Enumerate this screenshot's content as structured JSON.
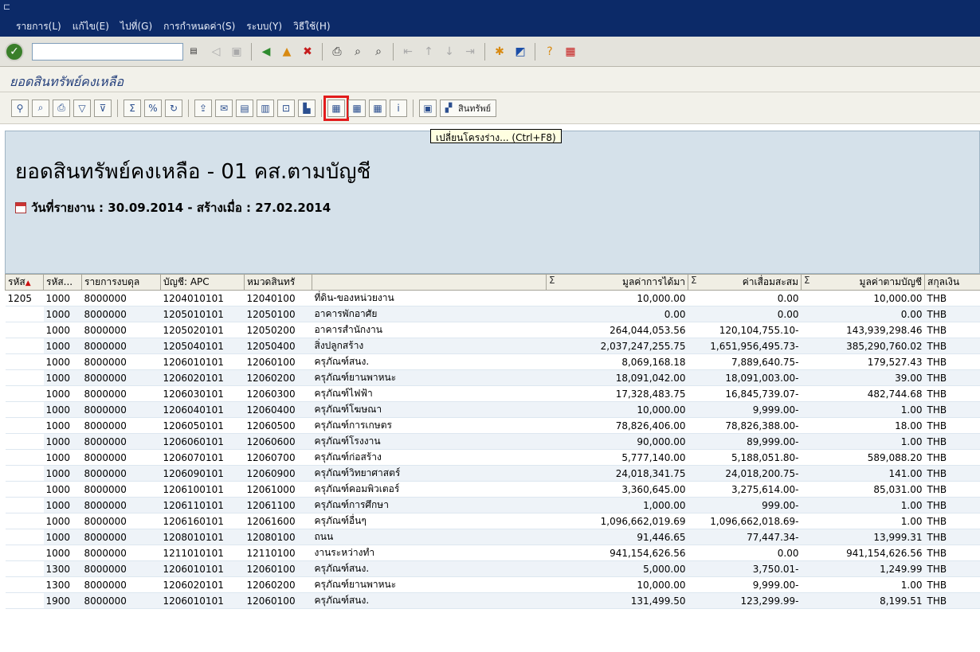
{
  "menu": {
    "items": [
      "รายการ(L)",
      "แก้ไข(E)",
      "ไปที่(G)",
      "การกำหนดค่า(S)",
      "ระบบ(Y)",
      "วิธีใช้(H)"
    ]
  },
  "screen": {
    "title": "ยอดสินทรัพย์คงเหลือ"
  },
  "toolbar": {
    "asset_button_label": "สินทรัพย์"
  },
  "tooltip": {
    "text": "เปลี่ยนโครงร่าง...   (Ctrl+F8)"
  },
  "report": {
    "title": "ยอดสินทรัพย์คงเหลือ - 01 คส.ตามบัญชี",
    "subtitle": "วันที่รายงาน : 30.09.2014 - สร้างเมื่อ : 27.02.2014"
  },
  "table": {
    "columns": [
      "รหัส",
      "รหัส...",
      "รายการงบดุล",
      "บัญชี: APC",
      "หมวดสินทรั",
      "",
      "มูลค่าการได้มา",
      "ค่าเสื่อมสะสม",
      "มูลค่าตามบัญชี",
      "สกุลเงิน"
    ],
    "rows": [
      [
        "1205",
        "1000",
        "8000000",
        "1204010101",
        "12040100",
        "ที่ดิน-ของหน่วยงาน",
        "10,000.00",
        "0.00",
        "10,000.00",
        "THB"
      ],
      [
        "",
        "1000",
        "8000000",
        "1205010101",
        "12050100",
        "อาคารพักอาศัย",
        "0.00",
        "0.00",
        "0.00",
        "THB"
      ],
      [
        "",
        "1000",
        "8000000",
        "1205020101",
        "12050200",
        "อาคารสำนักงาน",
        "264,044,053.56",
        "120,104,755.10-",
        "143,939,298.46",
        "THB"
      ],
      [
        "",
        "1000",
        "8000000",
        "1205040101",
        "12050400",
        "สิ่งปลูกสร้าง",
        "2,037,247,255.75",
        "1,651,956,495.73-",
        "385,290,760.02",
        "THB"
      ],
      [
        "",
        "1000",
        "8000000",
        "1206010101",
        "12060100",
        "ครุภัณฑ์สนง.",
        "8,069,168.18",
        "7,889,640.75-",
        "179,527.43",
        "THB"
      ],
      [
        "",
        "1000",
        "8000000",
        "1206020101",
        "12060200",
        "ครุภัณฑ์ยานพาหนะ",
        "18,091,042.00",
        "18,091,003.00-",
        "39.00",
        "THB"
      ],
      [
        "",
        "1000",
        "8000000",
        "1206030101",
        "12060300",
        "ครุภัณฑ์ไฟฟ้า",
        "17,328,483.75",
        "16,845,739.07-",
        "482,744.68",
        "THB"
      ],
      [
        "",
        "1000",
        "8000000",
        "1206040101",
        "12060400",
        "ครุภัณฑ์โฆษณา",
        "10,000.00",
        "9,999.00-",
        "1.00",
        "THB"
      ],
      [
        "",
        "1000",
        "8000000",
        "1206050101",
        "12060500",
        "ครุภัณฑ์การเกษตร",
        "78,826,406.00",
        "78,826,388.00-",
        "18.00",
        "THB"
      ],
      [
        "",
        "1000",
        "8000000",
        "1206060101",
        "12060600",
        "ครุภัณฑ์โรงงาน",
        "90,000.00",
        "89,999.00-",
        "1.00",
        "THB"
      ],
      [
        "",
        "1000",
        "8000000",
        "1206070101",
        "12060700",
        "ครุภัณฑ์ก่อสร้าง",
        "5,777,140.00",
        "5,188,051.80-",
        "589,088.20",
        "THB"
      ],
      [
        "",
        "1000",
        "8000000",
        "1206090101",
        "12060900",
        "ครุภัณฑ์วิทยาศาสตร์",
        "24,018,341.75",
        "24,018,200.75-",
        "141.00",
        "THB"
      ],
      [
        "",
        "1000",
        "8000000",
        "1206100101",
        "12061000",
        "ครุภัณฑ์คอมพิวเตอร์",
        "3,360,645.00",
        "3,275,614.00-",
        "85,031.00",
        "THB"
      ],
      [
        "",
        "1000",
        "8000000",
        "1206110101",
        "12061100",
        "ครุภัณฑ์การศึกษา",
        "1,000.00",
        "999.00-",
        "1.00",
        "THB"
      ],
      [
        "",
        "1000",
        "8000000",
        "1206160101",
        "12061600",
        "ครุภัณฑ์อื่นๆ",
        "1,096,662,019.69",
        "1,096,662,018.69-",
        "1.00",
        "THB"
      ],
      [
        "",
        "1000",
        "8000000",
        "1208010101",
        "12080100",
        "ถนน",
        "91,446.65",
        "77,447.34-",
        "13,999.31",
        "THB"
      ],
      [
        "",
        "1000",
        "8000000",
        "1211010101",
        "12110100",
        "งานระหว่างทำ",
        "941,154,626.56",
        "0.00",
        "941,154,626.56",
        "THB"
      ],
      [
        "",
        "1300",
        "8000000",
        "1206010101",
        "12060100",
        "ครุภัณฑ์สนง.",
        "5,000.00",
        "3,750.01-",
        "1,249.99",
        "THB"
      ],
      [
        "",
        "1300",
        "8000000",
        "1206020101",
        "12060200",
        "ครุภัณฑ์ยานพาหนะ",
        "10,000.00",
        "9,999.00-",
        "1.00",
        "THB"
      ],
      [
        "",
        "1900",
        "8000000",
        "1206010101",
        "12060100",
        "ครุภัณฑ์สนง.",
        "131,499.50",
        "123,299.99-",
        "8,199.51",
        "THB"
      ]
    ]
  }
}
